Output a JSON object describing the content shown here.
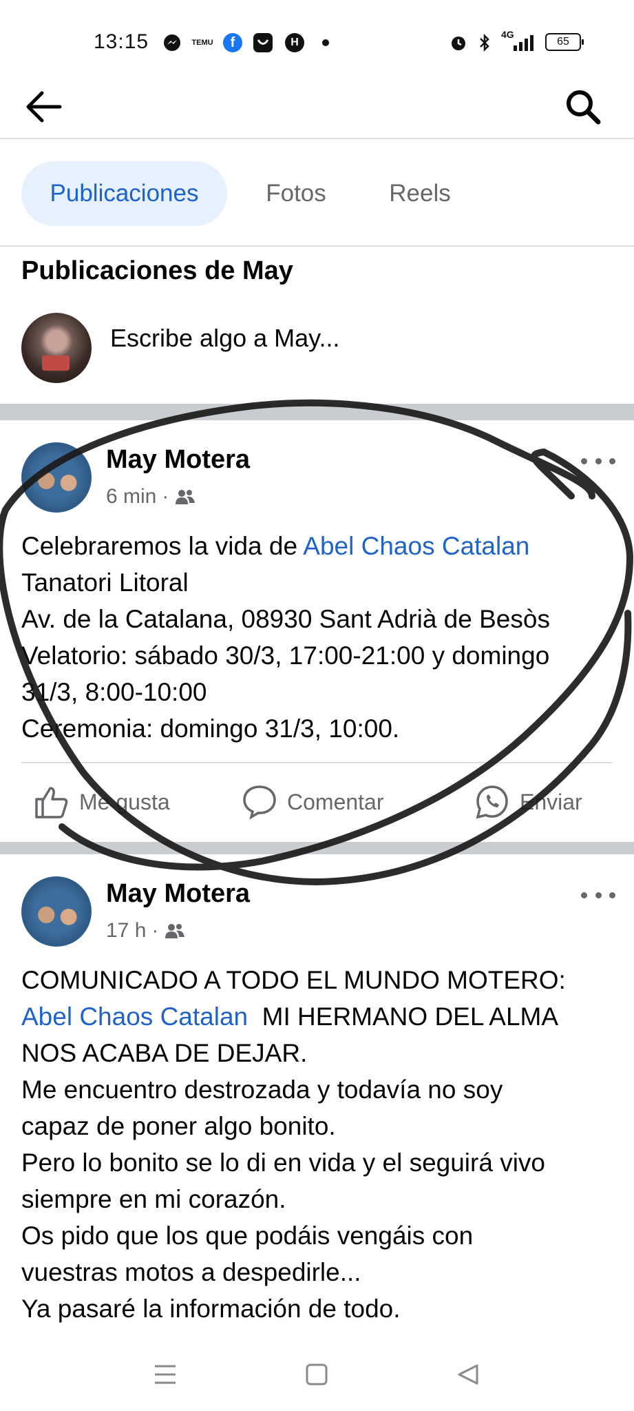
{
  "status_bar": {
    "time": "13:15",
    "network": "4G",
    "battery": "65",
    "notification_icons": [
      "messenger-icon",
      "temu-icon",
      "facebook-icon",
      "app-icon",
      "h-app-icon"
    ],
    "temu_text": "TEMU",
    "h_app_text": "H",
    "fb_text": "f"
  },
  "header": {
    "back_icon": "arrow-left-icon",
    "search_icon": "search-icon"
  },
  "tabs": [
    {
      "label": "Publicaciones",
      "active": true
    },
    {
      "label": "Fotos",
      "active": false
    },
    {
      "label": "Reels",
      "active": false
    }
  ],
  "profile": {
    "section_title": "Publicaciones de May",
    "compose_placeholder": "Escribe algo a May..."
  },
  "posts": [
    {
      "author": "May Motera",
      "time": "6 min",
      "audience_icon": "friends-icon",
      "lines": [
        {
          "text": "Celebraremos la vida de ",
          "mention": "Abel Chaos Catalan"
        },
        {
          "text": "Tanatori Litoral"
        },
        {
          "text": "Av. de la Catalana, 08930 Sant Adrià de Besòs"
        },
        {
          "text": "Velatorio: sábado 30/3, 17:00-21:00 y domingo"
        },
        {
          "text": "31/3, 8:00-10:00"
        },
        {
          "text": "Ceremonia: domingo 31/3, 10:00."
        }
      ],
      "actions": {
        "like": "Me gusta",
        "comment": "Comentar",
        "share": "Enviar"
      }
    },
    {
      "author": "May Motera",
      "time": "17 h",
      "audience_icon": "friends-icon",
      "lines": [
        {
          "text": "COMUNICADO A TODO EL MUNDO MOTERO:"
        },
        {
          "mention": "Abel Chaos Catalan",
          "text_after": "  MI HERMANO DEL ALMA"
        },
        {
          "text": "NOS ACABA DE DEJAR."
        },
        {
          "text": "Me encuentro destrozada y todavía no soy"
        },
        {
          "text": "capaz de poner algo bonito."
        },
        {
          "text": "Pero lo bonito se lo di en vida y el seguirá vivo"
        },
        {
          "text": "siempre en mi corazón."
        },
        {
          "text": "Os pido que los que podáis vengáis con"
        },
        {
          "text": "vuestras motos a despedirle..."
        },
        {
          "text": "Ya pasaré la información de todo."
        }
      ]
    }
  ],
  "nav_bar": {
    "icons": [
      "menu-lines-icon",
      "home-square-icon",
      "back-triangle-icon"
    ]
  }
}
